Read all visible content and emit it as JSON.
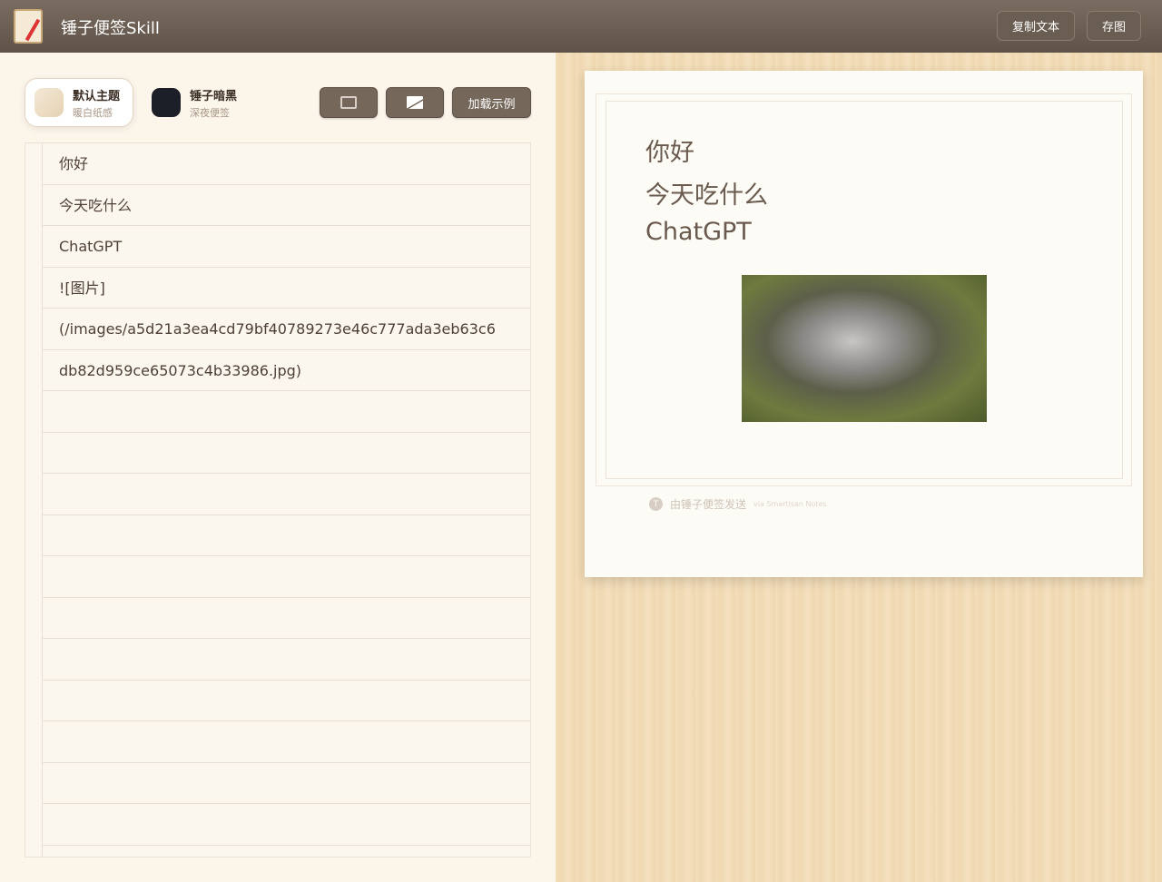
{
  "header": {
    "title": "锤子便签Skill",
    "copy_text": "复制文本",
    "save_image": "存图"
  },
  "themes": [
    {
      "name": "默认主题",
      "sub": "暖白纸感",
      "color": "#eedfc6"
    },
    {
      "name": "锤子暗黑",
      "sub": "深夜便签",
      "color": "#1c1f28"
    }
  ],
  "toolbar": {
    "load_example": "加载示例"
  },
  "editor": {
    "lines": [
      "你好",
      "今天吃什么",
      "ChatGPT",
      "![图片]",
      "(/images/a5d21a3ea4cd79bf40789273e46c777ada3eb63c6",
      "db82d959ce65073c4b33986.jpg)",
      "",
      "",
      "",
      "",
      "",
      "",
      "",
      "",
      "",
      "",
      ""
    ]
  },
  "preview": {
    "lines": [
      "你好",
      "今天吃什么",
      "ChatGPT"
    ],
    "footer_icon": "T",
    "footer_text": "由锤子便签发送",
    "footer_sub": "via Smartisan Notes"
  }
}
